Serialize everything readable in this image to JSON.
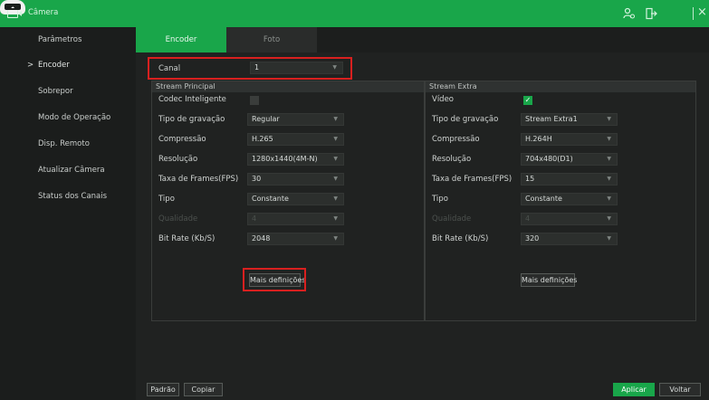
{
  "window": {
    "title": "Câmera"
  },
  "sidebar": {
    "items": [
      {
        "label": "Parâmetros"
      },
      {
        "label": "Encoder",
        "arrow": ">"
      },
      {
        "label": "Sobrepor"
      },
      {
        "label": "Modo de Operação"
      },
      {
        "label": "Disp. Remoto"
      },
      {
        "label": "Atualizar Câmera"
      },
      {
        "label": "Status dos Canais"
      }
    ]
  },
  "tabs": [
    {
      "label": "Encoder"
    },
    {
      "label": "Foto"
    }
  ],
  "channel": {
    "label": "Canal",
    "value": "1"
  },
  "main_stream": {
    "title": "Stream Principal",
    "fields": [
      {
        "label": "Codec Inteligente",
        "checked": false
      },
      {
        "label": "Tipo de gravação",
        "value": "Regular"
      },
      {
        "label": "Compressão",
        "value": "H.265"
      },
      {
        "label": "Resolução",
        "value": "1280x1440(4M-N)"
      },
      {
        "label": "Taxa de Frames(FPS)",
        "value": "30"
      },
      {
        "label": "Tipo",
        "value": "Constante"
      },
      {
        "label": "Qualidade",
        "value": "4"
      },
      {
        "label": "Bit Rate (Kb/S)",
        "value": "2048"
      }
    ],
    "more_button": "Mais definições"
  },
  "extra_stream": {
    "title": "Stream Extra",
    "fields": [
      {
        "label": "Vídeo",
        "checked": true
      },
      {
        "label": "Tipo de gravação",
        "value": "Stream Extra1"
      },
      {
        "label": "Compressão",
        "value": "H.264H"
      },
      {
        "label": "Resolução",
        "value": "704x480(D1)"
      },
      {
        "label": "Taxa de Frames(FPS)",
        "value": "15"
      },
      {
        "label": "Tipo",
        "value": "Constante"
      },
      {
        "label": "Qualidade",
        "value": "4"
      },
      {
        "label": "Bit Rate (Kb/S)",
        "value": "320"
      }
    ],
    "more_button": "Mais definições"
  },
  "footer": {
    "default": "Padrão",
    "copy": "Copiar",
    "apply": "Aplicar",
    "back": "Voltar"
  },
  "colors": {
    "accent": "#19a64a",
    "highlight": "#d8201f"
  }
}
